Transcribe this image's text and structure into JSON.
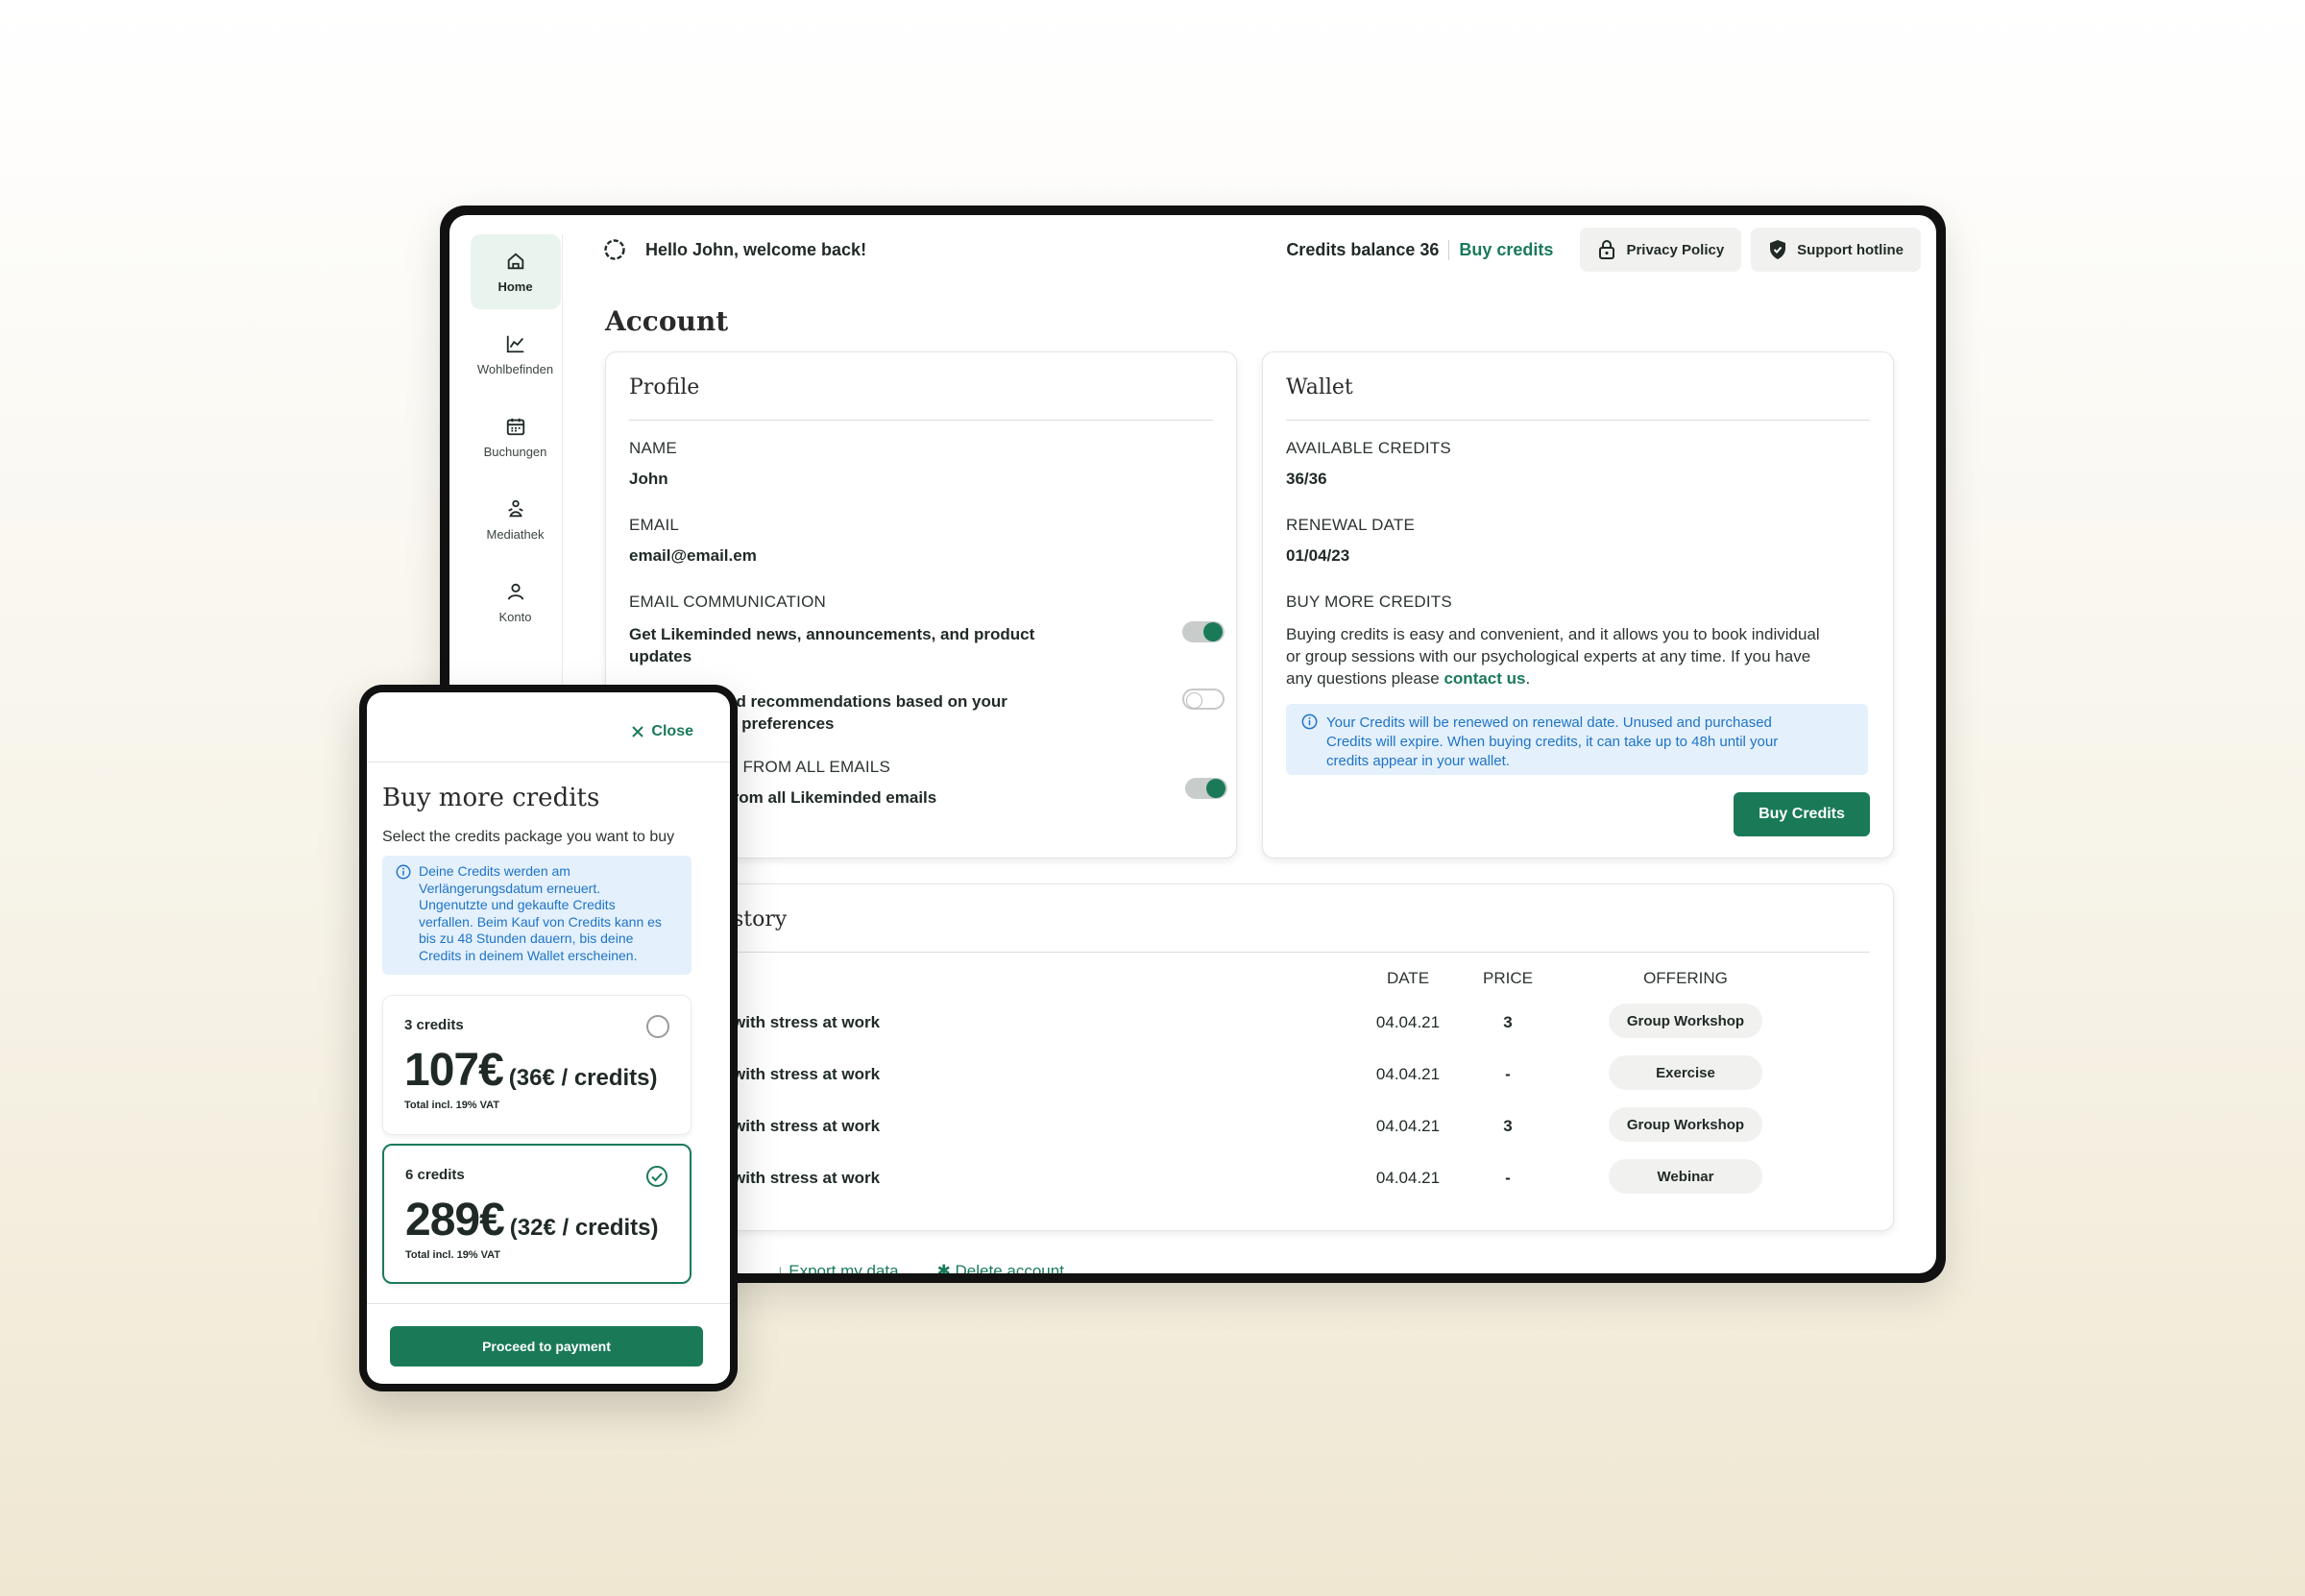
{
  "sidebar": {
    "items": [
      {
        "label": "Home",
        "icon": "home-icon",
        "active": true
      },
      {
        "label": "Wohlbefinden",
        "icon": "chart-line-icon"
      },
      {
        "label": "Buchungen",
        "icon": "calendar-icon"
      },
      {
        "label": "Mediathek",
        "icon": "meditation-icon"
      },
      {
        "label": "Konto",
        "icon": "user-icon"
      }
    ]
  },
  "topbar": {
    "welcome": "Hello John, welcome back!",
    "balance": "Credits balance 36",
    "buy_link": "Buy credits",
    "privacy": "Privacy Policy",
    "support": "Support hotline"
  },
  "page": {
    "title": "Account"
  },
  "profile": {
    "title": "Profile",
    "name_label": "NAME",
    "name_value": "John",
    "email_label": "EMAIL",
    "email_value": "email@email.em",
    "comm_label": "EMAIL COMMUNICATION",
    "opt1_l1": "Get Likeminded news, announcements, and product",
    "opt1_l2": "updates",
    "opt1_on": true,
    "opt2_l1": "ed recommendations based on your",
    "opt2_l2": "d preferences",
    "opt2_on": false,
    "unsub_label": "E FROM ALL EMAILS",
    "unsub_text": "from all Likeminded emails",
    "unsub_on": true
  },
  "wallet": {
    "title": "Wallet",
    "avail_label": "AVAILABLE CREDITS",
    "avail_value": "36/36",
    "renew_label": "RENEWAL DATE",
    "renew_value": "01/04/23",
    "buy_label": "BUY MORE CREDITS",
    "buy_text_1": "Buying credits is easy and convenient, and it allows you to book individual",
    "buy_text_2": "or group sessions with our psychological experts at any time. If you have",
    "buy_text_3": "any questions please",
    "contact_link": "contact us",
    "buy_text_end": ".",
    "info_1": "Your Credits will be renewed on renewal date. Unused and purchased",
    "info_2": "Credits will expire. When buying credits, it can take up to 48h until your",
    "info_3": "credits appear in your wallet.",
    "button": "Buy Credits"
  },
  "history": {
    "title": "story",
    "headers": {
      "date": "DATE",
      "price": "PRICE",
      "offering": "OFFERING"
    },
    "rows": [
      {
        "name": "with stress at work",
        "date": "04.04.21",
        "price": "3",
        "offering": "Group Workshop"
      },
      {
        "name": "with stress at work",
        "date": "04.04.21",
        "price": "-",
        "offering": "Exercise"
      },
      {
        "name": "with stress at work",
        "date": "04.04.21",
        "price": "3",
        "offering": "Group Workshop"
      },
      {
        "name": "with stress at work",
        "date": "04.04.21",
        "price": "-",
        "offering": "Webinar"
      }
    ]
  },
  "footer": {
    "export": "Export my data",
    "delete": "Delete account"
  },
  "modal": {
    "close": "Close",
    "title": "Buy more credits",
    "subtitle": "Select the credits package you want to buy",
    "info_1": "Deine Credits werden am",
    "info_2": "Verlängerungsdatum erneuert.",
    "info_3": "Ungenutzte und gekaufte Credits",
    "info_4": "verfallen. Beim Kauf von Credits kann es",
    "info_5": "bis zu 48 Stunden dauern, bis deine",
    "info_6": "Credits in deinem Wallet erscheinen.",
    "packages": [
      {
        "name": "3 credits",
        "price": "107€",
        "per": "(36€ / credits)",
        "vat": "Total incl. 19% VAT",
        "selected": false
      },
      {
        "name": "6 credits",
        "price": "289€",
        "per": "(32€ / credits)",
        "vat": "Total incl. 19% VAT",
        "selected": true
      }
    ],
    "proceed": "Proceed to payment"
  },
  "colors": {
    "accent": "#1a7a58",
    "info_bg": "#e4f0fb",
    "info_text": "#1e74c8"
  }
}
